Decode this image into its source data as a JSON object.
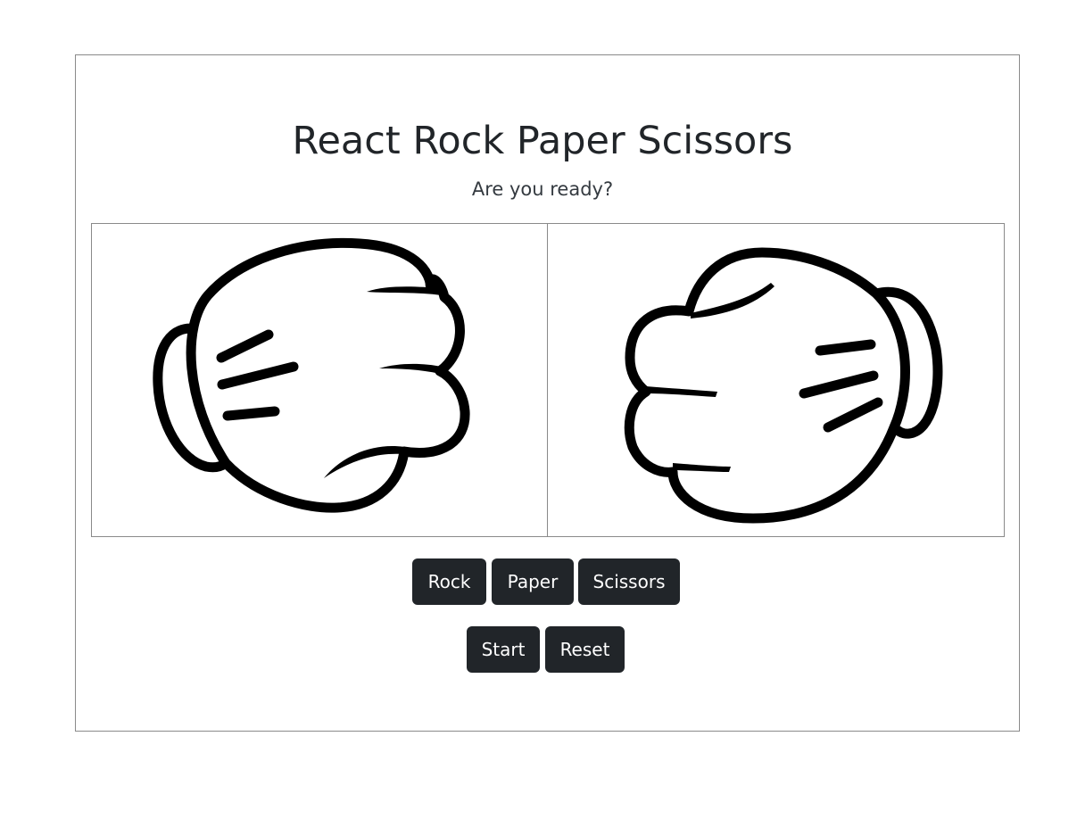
{
  "app": {
    "title": "React Rock Paper Scissors",
    "status": "Are you ready?"
  },
  "board": {
    "player_hand": {
      "shape": "rock",
      "icon": "fist-icon"
    },
    "computer_hand": {
      "shape": "rock",
      "icon": "fist-icon"
    }
  },
  "choices": {
    "rock_label": "Rock",
    "paper_label": "Paper",
    "scissors_label": "Scissors"
  },
  "controls": {
    "start_label": "Start",
    "reset_label": "Reset"
  },
  "colors": {
    "button_bg": "#212529",
    "button_text": "#ffffff",
    "border": "#8a8a8a",
    "text": "#212529"
  }
}
